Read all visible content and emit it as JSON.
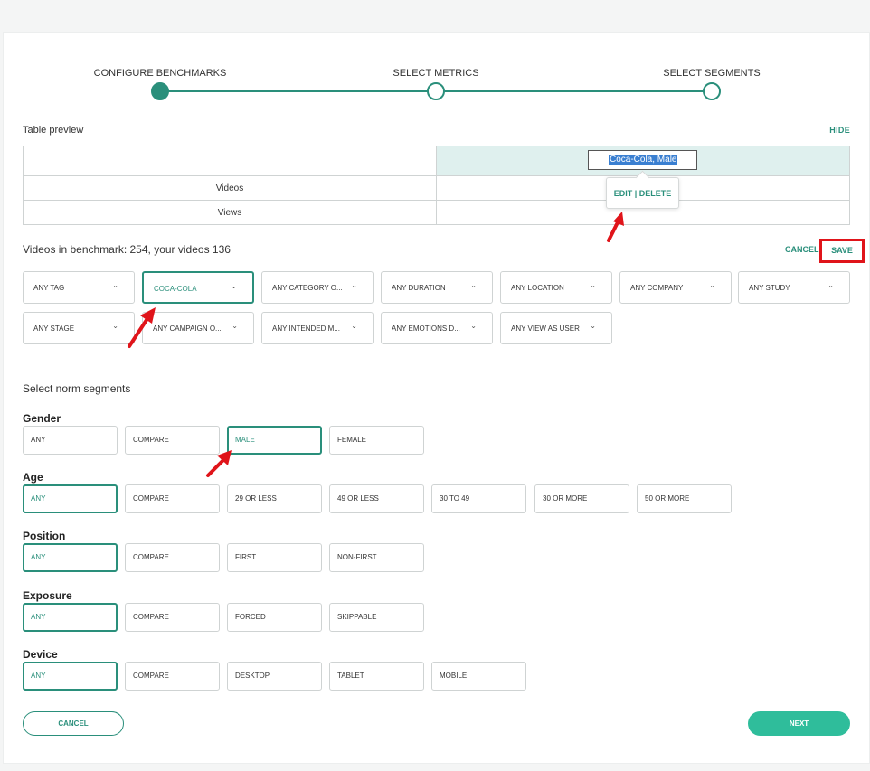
{
  "stepper": {
    "steps": [
      {
        "label": "CONFIGURE BENCHMARKS",
        "state": "done"
      },
      {
        "label": "SELECT METRICS",
        "state": "todo"
      },
      {
        "label": "SELECT SEGMENTS",
        "state": "todo"
      }
    ]
  },
  "preview": {
    "title": "Table preview",
    "hide_label": "HIDE",
    "column_name": "Coca-Cola, Male",
    "rows": [
      "Videos",
      "Views"
    ],
    "tooltip": "EDIT | DELETE"
  },
  "benchmark": {
    "summary": "Videos in benchmark: 254, your videos 136",
    "cancel_label": "CANCEL",
    "save_label": "SAVE"
  },
  "filters": [
    {
      "label": "ANY TAG",
      "active": false
    },
    {
      "label": "COCA-COLA",
      "active": true
    },
    {
      "label": "ANY CATEGORY O...",
      "active": false
    },
    {
      "label": "ANY DURATION",
      "active": false
    },
    {
      "label": "ANY LOCATION",
      "active": false
    },
    {
      "label": "ANY COMPANY",
      "active": false
    },
    {
      "label": "ANY STUDY",
      "active": false
    },
    {
      "label": "ANY STAGE",
      "active": false
    },
    {
      "label": "ANY CAMPAIGN O...",
      "active": false
    },
    {
      "label": "ANY INTENDED M...",
      "active": false
    },
    {
      "label": "ANY EMOTIONS D...",
      "active": false
    },
    {
      "label": "ANY VIEW AS USER",
      "active": false
    }
  ],
  "segments": {
    "title": "Select norm segments",
    "groups": [
      {
        "name": "Gender",
        "options": [
          "ANY",
          "COMPARE",
          "MALE",
          "FEMALE"
        ],
        "selected": 2
      },
      {
        "name": "Age",
        "options": [
          "ANY",
          "COMPARE",
          "29 OR LESS",
          "49 OR LESS",
          "30 TO 49",
          "30 OR MORE",
          "50 OR MORE"
        ],
        "selected": 0
      },
      {
        "name": "Position",
        "options": [
          "ANY",
          "COMPARE",
          "FIRST",
          "NON-FIRST"
        ],
        "selected": 0
      },
      {
        "name": "Exposure",
        "options": [
          "ANY",
          "COMPARE",
          "FORCED",
          "SKIPPABLE"
        ],
        "selected": 0
      },
      {
        "name": "Device",
        "options": [
          "ANY",
          "COMPARE",
          "DESKTOP",
          "TABLET",
          "MOBILE"
        ],
        "selected": 0
      }
    ]
  },
  "footer": {
    "cancel_label": "CANCEL",
    "next_label": "NEXT"
  },
  "colors": {
    "accent": "#2a8f7b",
    "next_button": "#2fbd9b",
    "highlight_cell": "#dff0ee",
    "annotation_red": "#e0141a"
  }
}
